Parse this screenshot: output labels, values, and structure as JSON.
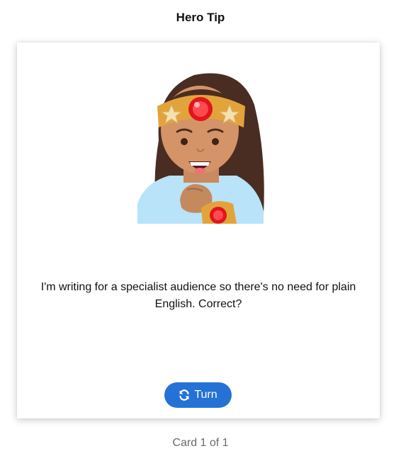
{
  "header": {
    "title": "Hero Tip"
  },
  "card": {
    "image_icon": "superhero-woman-icon",
    "text": "I'm writing for a specialist audience so there's no need for plain English. Correct?",
    "turn_button": {
      "label": "Turn",
      "icon": "refresh-icon"
    }
  },
  "footer": {
    "counter": "Card 1 of 1"
  },
  "colors": {
    "accent": "#2472d6",
    "counter_text": "#6b6b6b"
  }
}
